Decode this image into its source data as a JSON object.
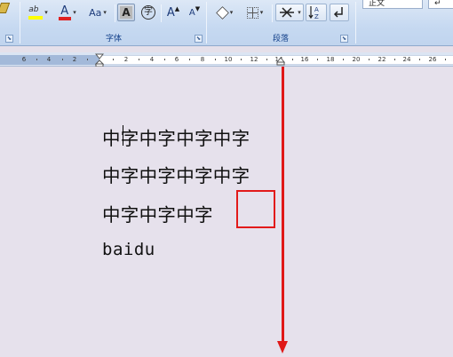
{
  "ribbon": {
    "font_group": {
      "caption": "字体",
      "change_case_label": "Aa",
      "font_color_label": "A",
      "grow_font_label": "A",
      "shrink_font_label": "A",
      "char_shading_label": "A",
      "highlight_label": "ab"
    },
    "paragraph_group": {
      "caption": "段落"
    },
    "styles": {
      "normal_label": "正文"
    },
    "colors": {
      "font_color_bar": "#e02020",
      "highlight_bar": "#ffff00"
    }
  },
  "ruler": {
    "left_numbers": [
      "6",
      "4",
      "2"
    ],
    "right_numbers": [
      "2",
      "4",
      "6",
      "8",
      "10",
      "12",
      "14",
      "16",
      "18",
      "20",
      "22",
      "24",
      "26"
    ]
  },
  "document": {
    "lines": [
      "中字中字中字中字",
      "中字中字中字中字",
      "中字中字中字",
      "baidu"
    ]
  },
  "annotation": {
    "color": "#e01818"
  }
}
